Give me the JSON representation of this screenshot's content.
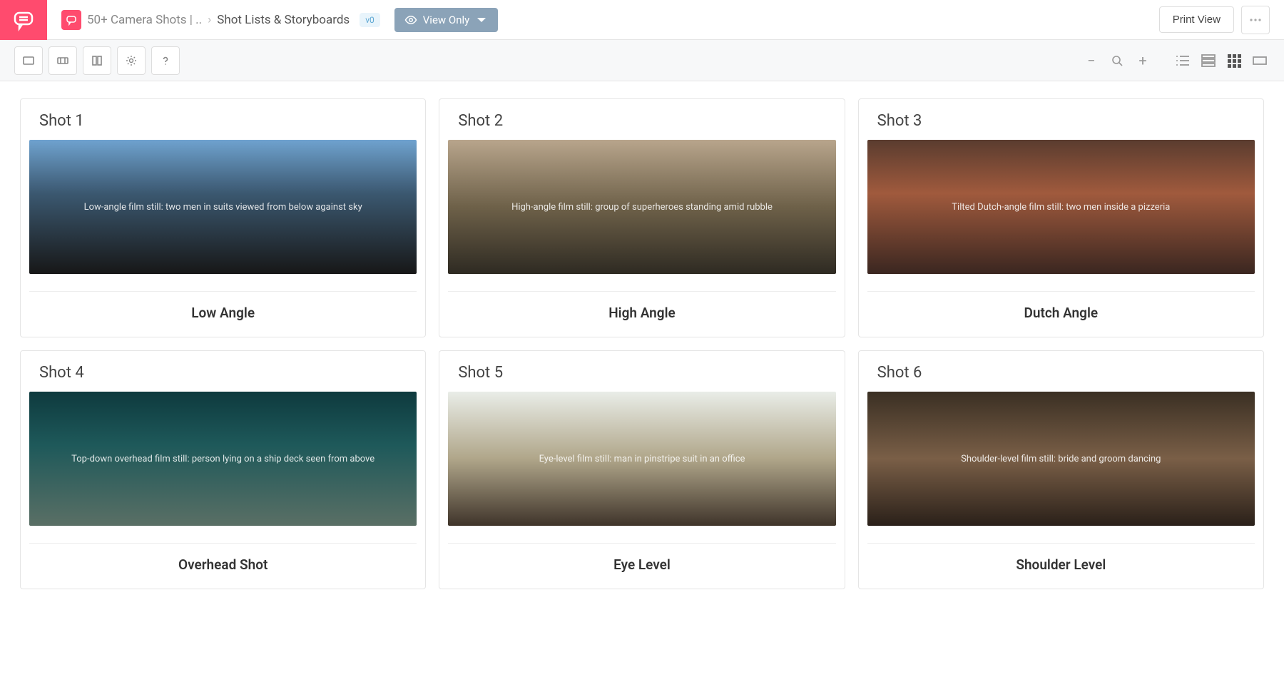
{
  "brand": {
    "color": "#ff4b6e"
  },
  "breadcrumb": {
    "project": "50+ Camera Shots | ..",
    "section": "Shot Lists & Storyboards",
    "version_label": "v0"
  },
  "view_mode": {
    "label": "View Only"
  },
  "topbar": {
    "print_label": "Print View"
  },
  "toolbar": {
    "tools": [
      "screen-icon",
      "filmstrip-icon",
      "split-icon",
      "gear-icon",
      "help-icon"
    ],
    "zoom_minus": "−",
    "zoom_plus": "+"
  },
  "shots": [
    {
      "id": 1,
      "title": "Shot 1",
      "caption": "Low Angle",
      "image_desc": "Low-angle film still: two men in suits viewed from below against sky"
    },
    {
      "id": 2,
      "title": "Shot 2",
      "caption": "High Angle",
      "image_desc": "High-angle film still: group of superheroes standing amid rubble"
    },
    {
      "id": 3,
      "title": "Shot 3",
      "caption": "Dutch Angle",
      "image_desc": "Tilted Dutch-angle film still: two men inside a pizzeria"
    },
    {
      "id": 4,
      "title": "Shot 4",
      "caption": "Overhead Shot",
      "image_desc": "Top-down overhead film still: person lying on a ship deck seen from above"
    },
    {
      "id": 5,
      "title": "Shot 5",
      "caption": "Eye Level",
      "image_desc": "Eye-level film still: man in pinstripe suit in an office"
    },
    {
      "id": 6,
      "title": "Shot 6",
      "caption": "Shoulder Level",
      "image_desc": "Shoulder-level film still: bride and groom dancing"
    }
  ]
}
